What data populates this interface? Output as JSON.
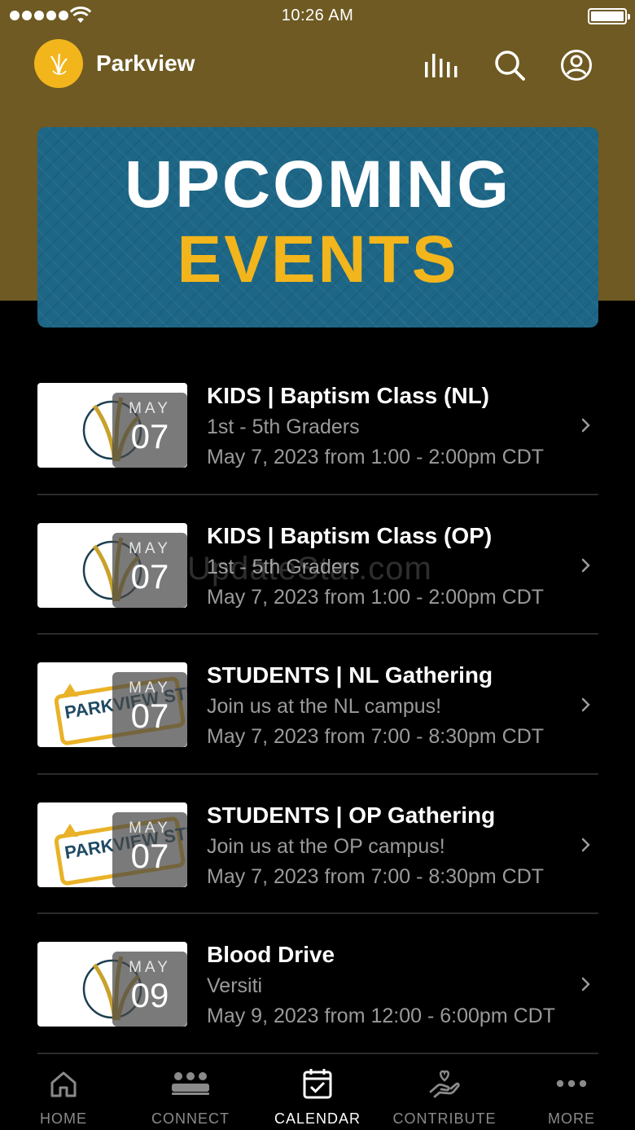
{
  "status_bar": {
    "time": "10:26 AM"
  },
  "header": {
    "title": "Parkview"
  },
  "banner": {
    "line1": "UPCOMING",
    "line2": "EVENTS"
  },
  "events": [
    {
      "month": "MAY",
      "day": "07",
      "title": "KIDS | Baptism Class (NL)",
      "subtitle": "1st - 5th Graders",
      "date": "May 7, 2023 from 1:00 - 2:00pm CDT",
      "thumb": "parkview-logo"
    },
    {
      "month": "MAY",
      "day": "07",
      "title": "KIDS | Baptism Class (OP)",
      "subtitle": "1st - 5th Graders",
      "date": "May 7, 2023 from 1:00 - 2:00pm CDT",
      "thumb": "parkview-logo"
    },
    {
      "month": "MAY",
      "day": "07",
      "title": "STUDENTS | NL Gathering",
      "subtitle": "Join us at the NL campus!",
      "date": "May 7, 2023 from 7:00 - 8:30pm CDT",
      "thumb": "parkview-students-logo",
      "thumb_text": "PARKVIEW STUDENTS"
    },
    {
      "month": "MAY",
      "day": "07",
      "title": "STUDENTS | OP Gathering",
      "subtitle": "Join us at the OP campus!",
      "date": "May 7, 2023 from 7:00 - 8:30pm CDT",
      "thumb": "parkview-students-logo",
      "thumb_text": "PARKVIEW STUDENTS"
    },
    {
      "month": "MAY",
      "day": "09",
      "title": "Blood Drive",
      "subtitle": "Versiti",
      "date": "May 9, 2023 from 12:00 - 6:00pm CDT",
      "thumb": "parkview-logo"
    }
  ],
  "tabs": [
    {
      "label": "HOME",
      "icon": "home-icon"
    },
    {
      "label": "CONNECT",
      "icon": "people-icon"
    },
    {
      "label": "CALENDAR",
      "icon": "calendar-icon",
      "active": true
    },
    {
      "label": "CONTRIBUTE",
      "icon": "giving-hand-icon"
    },
    {
      "label": "MORE",
      "icon": "more-dots-icon"
    }
  ],
  "watermark": "UpdateStar.com",
  "colors": {
    "header_gold": "#6e5a22",
    "accent_yellow": "#f2b51c",
    "banner_teal": "#1d6686"
  }
}
